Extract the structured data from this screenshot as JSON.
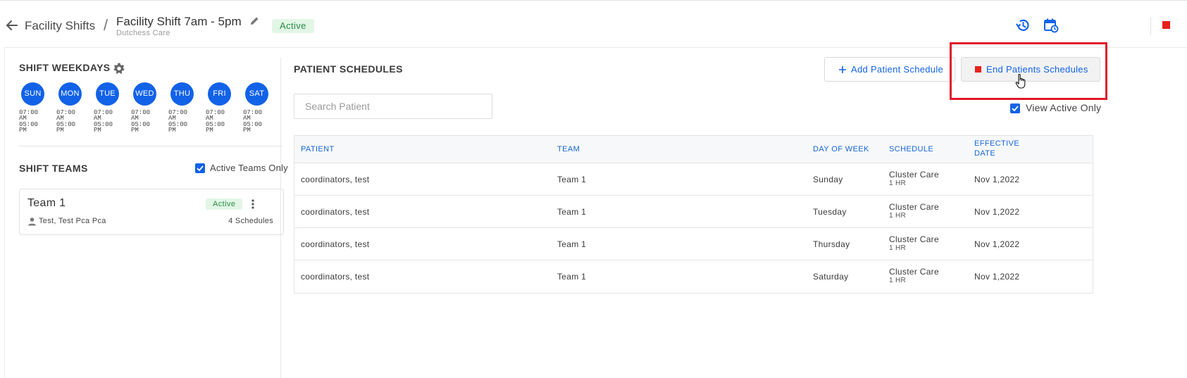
{
  "header": {
    "breadcrumb_parent": "Facility Shifts",
    "breadcrumb_separator": "/",
    "title": "Facility Shift 7am - 5pm",
    "subtitle": "Dutchess Care",
    "status": "Active",
    "icons": [
      "back-arrow-icon",
      "edit-pencil-icon",
      "history-icon",
      "calendar-sync-icon",
      "stop-icon"
    ]
  },
  "left": {
    "weekdays_title": "SHIFT WEEKDAYS",
    "days": [
      {
        "label": "SUN",
        "start_time": "07:00 AM",
        "end_time": "05:00 PM"
      },
      {
        "label": "MON",
        "start_time": "07:00 AM",
        "end_time": "05:00 PM"
      },
      {
        "label": "TUE",
        "start_time": "07:00 AM",
        "end_time": "05:00 PM"
      },
      {
        "label": "WED",
        "start_time": "07:00 AM",
        "end_time": "05:00 PM"
      },
      {
        "label": "THU",
        "start_time": "07:00 AM",
        "end_time": "05:00 PM"
      },
      {
        "label": "FRI",
        "start_time": "07:00 AM",
        "end_time": "05:00 PM"
      },
      {
        "label": "SAT",
        "start_time": "07:00 AM",
        "end_time": "05:00 PM"
      }
    ],
    "teams_title": "SHIFT TEAMS",
    "active_teams_only_label": "Active Teams Only",
    "active_teams_only_checked": true,
    "teams": [
      {
        "name": "Team 1",
        "status": "Active",
        "members": "Test, Test Pca Pca",
        "schedules": "4 Schedules"
      }
    ]
  },
  "right": {
    "title": "PATIENT SCHEDULES",
    "add_button_label": "Add Patient Schedule",
    "end_button_label": "End Patients Schedules",
    "search_placeholder": "Search Patient",
    "view_active_only_label": "View Active Only",
    "view_active_only_checked": true,
    "table": {
      "columns": [
        "PATIENT",
        "TEAM",
        "DAY OF WEEK",
        "SCHEDULE",
        "EFFECTIVE DATE"
      ],
      "rows": [
        {
          "patient": "coordinators, test",
          "team": "Team 1",
          "day": "Sunday",
          "schedule": "Cluster Care",
          "duration": "1 HR",
          "date": "Nov 1,2022"
        },
        {
          "patient": "coordinators, test",
          "team": "Team 1",
          "day": "Tuesday",
          "schedule": "Cluster Care",
          "duration": "1 HR",
          "date": "Nov 1,2022"
        },
        {
          "patient": "coordinators, test",
          "team": "Team 1",
          "day": "Thursday",
          "schedule": "Cluster Care",
          "duration": "1 HR",
          "date": "Nov 1,2022"
        },
        {
          "patient": "coordinators, test",
          "team": "Team 1",
          "day": "Saturday",
          "schedule": "Cluster Care",
          "duration": "1 HR",
          "date": "Nov 1,2022"
        }
      ]
    }
  },
  "colors": {
    "primary": "#1262e8",
    "link": "#1565d8",
    "active_bg": "#e2f6e6",
    "active_text": "#2a8b45",
    "stop_red": "#e8201c",
    "highlight_red": "#e0182a"
  }
}
